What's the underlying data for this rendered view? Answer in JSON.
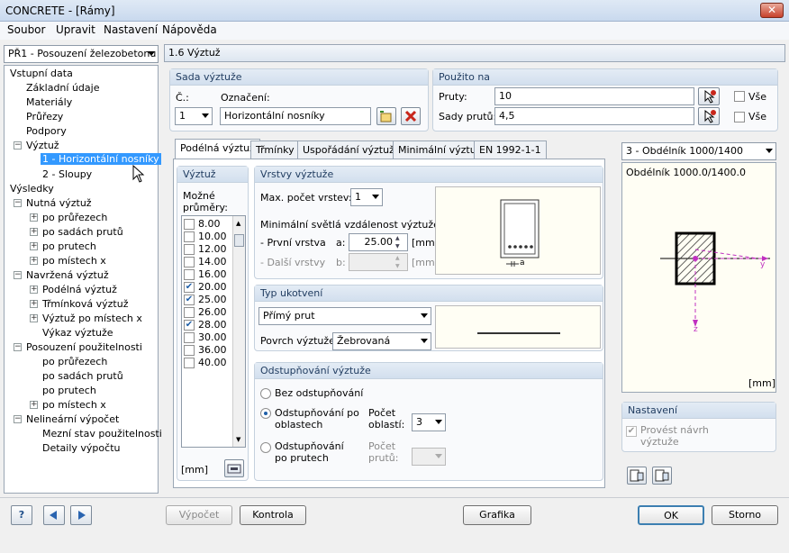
{
  "window": {
    "title": "CONCRETE - [Rámy]",
    "close": "✕"
  },
  "menu": [
    "Soubor",
    "Upravit",
    "Nastavení",
    "Nápověda"
  ],
  "case_select": "PŘ1 - Posouzení železobetonu",
  "section_title": "1.6 Výztuž",
  "tree": {
    "input": "Vstupní data",
    "basic": "Základní údaje",
    "materials": "Materiály",
    "sections": "Průřezy",
    "supports": "Podpory",
    "rebar": "Výztuž",
    "rebar1": "1 - Horizontální nosníky",
    "rebar2": "2 - Sloupy",
    "results": "Výsledky",
    "required": "Nutná výztuž",
    "req1": "po průřezech",
    "req2": "po sadách prutů",
    "req3": "po prutech",
    "req4": "po místech x",
    "provided": "Navržená výztuž",
    "prov1": "Podélná výztuž",
    "prov2": "Třmínková výztuž",
    "prov3": "Výztuž po místech x",
    "prov4": "Výkaz výztuže",
    "service": "Posouzení použitelnosti",
    "srv1": "po průřezech",
    "srv2": "po sadách prutů",
    "srv3": "po prutech",
    "srv4": "po místech x",
    "nonlin": "Nelineární výpočet",
    "nl1": "Mezní stav použitelnosti",
    "nl2": "Detaily výpočtu"
  },
  "set": {
    "header": "Sada výztuže",
    "no_label": "Č.:",
    "no_value": "1",
    "name_label": "Označení:",
    "name_value": "Horizontální nosníky"
  },
  "used": {
    "header": "Použito na",
    "members_label": "Pruty:",
    "members_value": "10",
    "sets_label": "Sady prutů:",
    "sets_value": "4,5",
    "all1": "Vše",
    "all2": "Vše"
  },
  "tabs": [
    "Podélná výztuž",
    "Třmínky",
    "Uspořádání výztuže",
    "Minimální výztuž",
    "EN 1992-1-1"
  ],
  "rebar_panel": {
    "header": "Výztuž",
    "possible": "Možné průměry:",
    "unit": "[mm]",
    "diameters": [
      {
        "v": "8.00",
        "c": ""
      },
      {
        "v": "10.00",
        "c": ""
      },
      {
        "v": "12.00",
        "c": ""
      },
      {
        "v": "14.00",
        "c": ""
      },
      {
        "v": "16.00",
        "c": ""
      },
      {
        "v": "20.00",
        "c": "✔"
      },
      {
        "v": "25.00",
        "c": "✔"
      },
      {
        "v": "26.00",
        "c": ""
      },
      {
        "v": "28.00",
        "c": "✔"
      },
      {
        "v": "30.00",
        "c": ""
      },
      {
        "v": "36.00",
        "c": ""
      },
      {
        "v": "40.00",
        "c": ""
      }
    ]
  },
  "layers": {
    "header": "Vrstvy výztuže",
    "max_label": "Max. počet vrstev:",
    "max_value": "1",
    "min_label": "Minimální světlá vzdálenost výztuže",
    "first_label": "- První vrstva",
    "first_sym": "a:",
    "first_value": "25.00",
    "next_label": "- Další vrstvy",
    "next_sym": "b:",
    "unit1": "[mm]",
    "unit2": "[mm]",
    "dim": "a"
  },
  "anchor": {
    "header": "Typ ukotvení",
    "type": "Přímý prut",
    "surface_label": "Povrch výztuže:",
    "surface": "Žebrovaná"
  },
  "staggering": {
    "header": "Odstupňování výztuže",
    "opt1": "Bez odstupňování",
    "opt2a": "Odstupňování po",
    "opt2b": "oblastech",
    "count_a": "Počet",
    "count_b": "oblastí:",
    "count_value": "3",
    "opt3a": "Odstupňování",
    "opt3b": "po prutech",
    "bars_a": "Počet",
    "bars_b": "prutů:"
  },
  "preview": {
    "select": "3 - Obdélník 1000/1400",
    "label": "Obdélník 1000.0/1400.0",
    "unit": "[mm]",
    "y": "y",
    "z": "z"
  },
  "settings": {
    "header": "Nastavení",
    "check_a": "Provést návrh",
    "check_b": "výztuže",
    "check_mark": "✔"
  },
  "buttons": {
    "calc": "Výpočet",
    "check": "Kontrola",
    "graphics": "Grafika",
    "ok": "OK",
    "cancel": "Storno",
    "help": "?"
  }
}
